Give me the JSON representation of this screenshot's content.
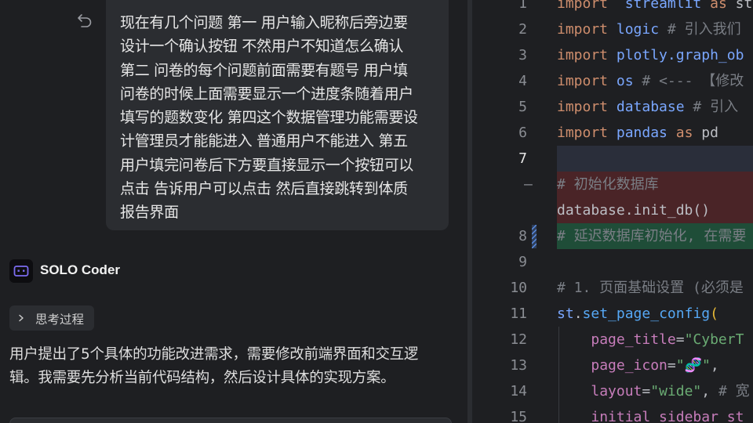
{
  "chat": {
    "user_message_lines": [
      "现在有几个问题 第一 用户输入昵称后旁边要",
      "设计一个确认按钮 不然用户不知道怎么确认",
      "第二 问卷的每个问题前面需要有题号 用户填",
      "问卷的时候上面需要显示一个进度条随着用户",
      "填写的题数变化 第四这个数据管理功能需要设",
      "计管理员才能能进入 普通用户不能进入 第五",
      "用户填完问卷后下方要直接显示一个按钮可以",
      "点击 告诉用户可以点击 然后直接跳转到体质",
      "报告界面"
    ],
    "agent_name": "SOLO Coder",
    "thinking_label": "思考过程",
    "response_lines": [
      "用户提出了5个具体的功能改进需求，需要修改前端界面和交互逻",
      "辑。我需要先分析当前代码结构，然后设计具体的实现方案。"
    ],
    "icons": {
      "undo": "undo-icon",
      "avatar": "robot-icon",
      "chevron": "chevron-right-icon"
    }
  },
  "editor": {
    "lines": [
      {
        "ln": "1",
        "tokens": [
          [
            "kw",
            "import"
          ],
          [
            "",
            "  "
          ],
          [
            "mod",
            "streamlit"
          ],
          [
            "",
            " "
          ],
          [
            "kw",
            "as"
          ],
          [
            "",
            " st"
          ]
        ]
      },
      {
        "ln": "2",
        "tokens": [
          [
            "kw",
            "import"
          ],
          [
            "",
            " "
          ],
          [
            "mod",
            "logic"
          ],
          [
            "",
            " "
          ],
          [
            "cm",
            "# 引入我们"
          ]
        ]
      },
      {
        "ln": "3",
        "tokens": [
          [
            "kw",
            "import"
          ],
          [
            "",
            " "
          ],
          [
            "mod",
            "plotly.graph_ob"
          ]
        ]
      },
      {
        "ln": "4",
        "tokens": [
          [
            "kw",
            "import"
          ],
          [
            "",
            " "
          ],
          [
            "mod",
            "os"
          ],
          [
            "",
            " "
          ],
          [
            "cm",
            "# <--- 【修改"
          ]
        ]
      },
      {
        "ln": "5",
        "tokens": [
          [
            "kw",
            "import"
          ],
          [
            "",
            " "
          ],
          [
            "mod",
            "database"
          ],
          [
            "",
            " "
          ],
          [
            "cm",
            "# 引入"
          ]
        ]
      },
      {
        "ln": "6",
        "tokens": [
          [
            "kw",
            "import"
          ],
          [
            "",
            " "
          ],
          [
            "mod",
            "pandas"
          ],
          [
            "",
            " "
          ],
          [
            "kw",
            "as"
          ],
          [
            "",
            " pd"
          ]
        ]
      },
      {
        "ln": "7",
        "tokens": []
      },
      {
        "ln": "",
        "tokens": [
          [
            "cm",
            "# 初始化数据库"
          ]
        ]
      },
      {
        "ln": "",
        "tokens": [
          [
            "",
            "database.init_db()"
          ]
        ]
      },
      {
        "ln": "8",
        "tokens": [
          [
            "cm",
            "# 延迟数据库初始化, 在需要"
          ]
        ]
      },
      {
        "ln": "9",
        "tokens": []
      },
      {
        "ln": "10",
        "tokens": [
          [
            "cm",
            "# 1. 页面基础设置 (必须是"
          ]
        ]
      },
      {
        "ln": "11",
        "tokens": [
          [
            "mod",
            "st"
          ],
          [
            "",
            "."
          ],
          [
            "fn",
            "set_page_config"
          ],
          [
            "par",
            "("
          ]
        ]
      },
      {
        "ln": "12",
        "tokens": [
          [
            "",
            "    "
          ],
          [
            "pname",
            "page_title"
          ],
          [
            "",
            "="
          ],
          [
            "str",
            "\"CyberT"
          ]
        ]
      },
      {
        "ln": "13",
        "tokens": [
          [
            "",
            "    "
          ],
          [
            "pname",
            "page_icon"
          ],
          [
            "",
            "="
          ],
          [
            "str",
            "\"🧬\""
          ],
          [
            "",
            ","
          ]
        ]
      },
      {
        "ln": "14",
        "tokens": [
          [
            "",
            "    "
          ],
          [
            "pname",
            "layout"
          ],
          [
            "",
            "="
          ],
          [
            "str",
            "\"wide\""
          ],
          [
            "",
            ", "
          ],
          [
            "cm",
            "# 宽"
          ]
        ]
      },
      {
        "ln": "15",
        "tokens": [
          [
            "",
            "    "
          ],
          [
            "pname",
            "initial_sidebar_st"
          ]
        ]
      }
    ]
  },
  "colors": {
    "background": "#1e1f22",
    "bubble": "#2b2d31",
    "keyword": "#cf8e6d",
    "module": "#7aa7ff",
    "comment": "#7a7e85",
    "string": "#6aab73",
    "deleted_bg": "#4a2427",
    "added_bg": "#1f4d38"
  }
}
